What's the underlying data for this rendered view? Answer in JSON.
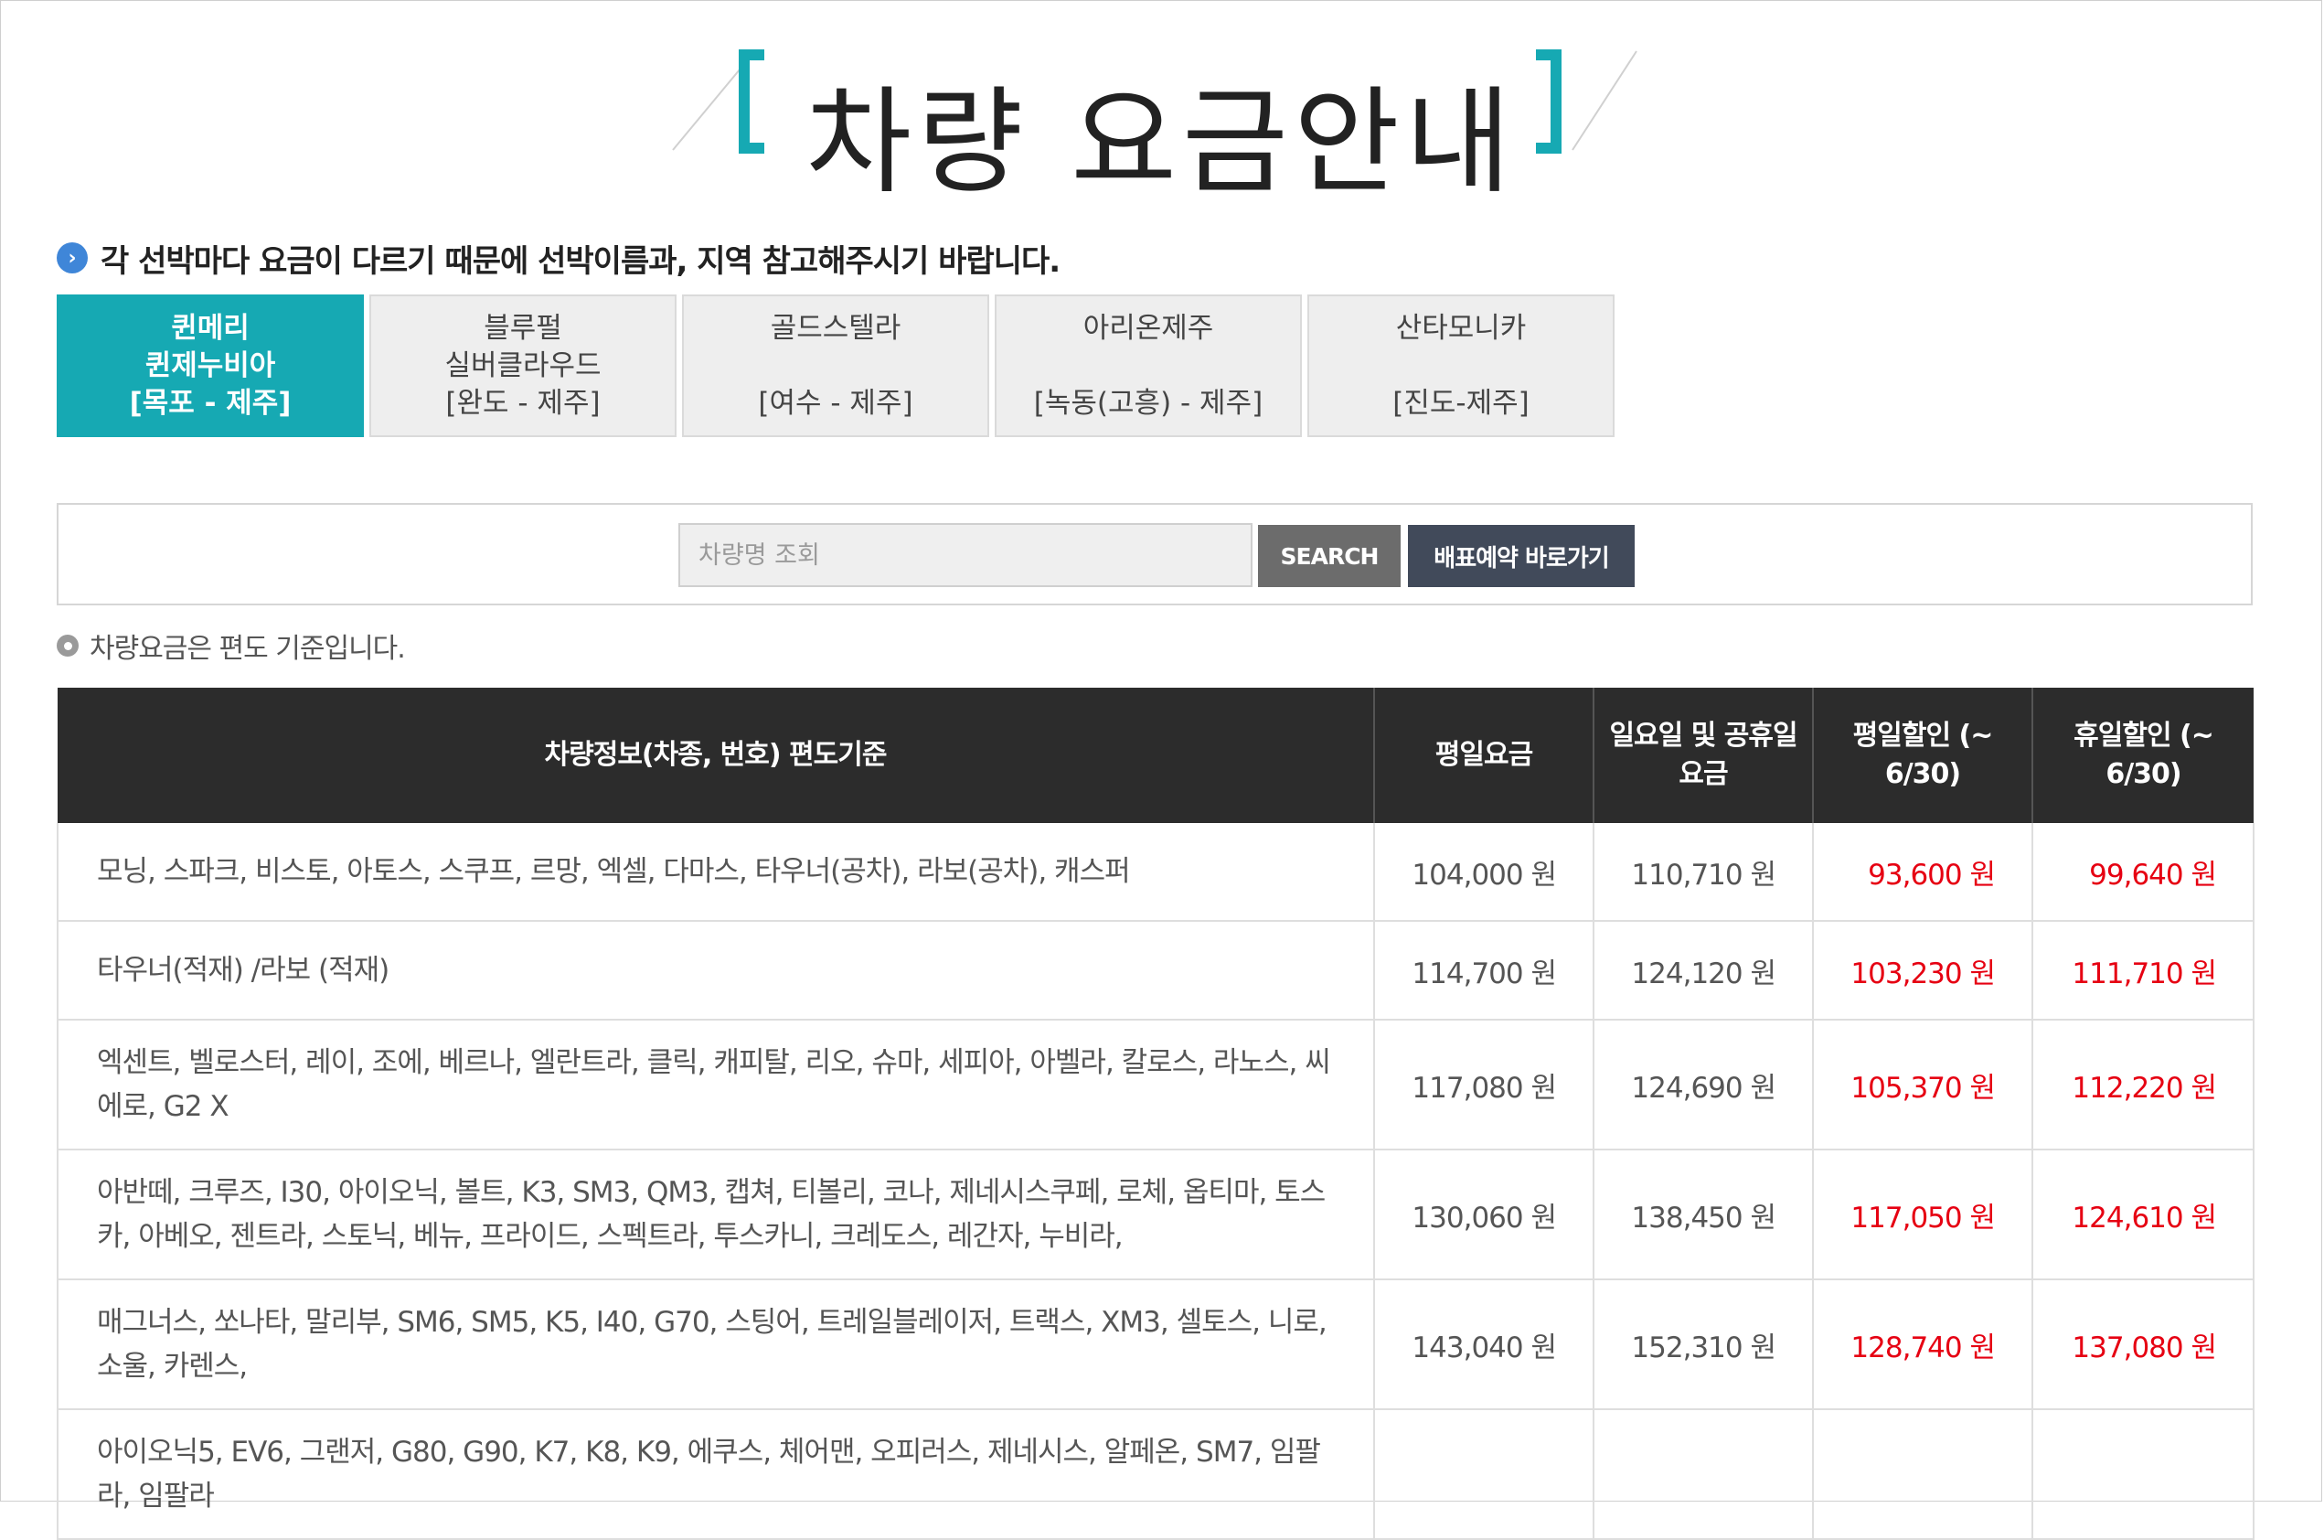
{
  "page": {
    "title": "차량 요금안내"
  },
  "notice": "각 선박마다 요금이 다르기 때문에 선박이름과, 지역 참고해주시기 바랍니다.",
  "tabs": [
    {
      "line1": "퀸메리",
      "line2": "퀸제누비아",
      "line3": "[목포 - 제주]",
      "active": true
    },
    {
      "line1": "블루펄",
      "line2": "실버클라우드",
      "line3": "[완도 - 제주]",
      "active": false
    },
    {
      "line1": "골드스텔라",
      "line2": "",
      "line3": "[여수 - 제주]",
      "active": false
    },
    {
      "line1": "아리온제주",
      "line2": "",
      "line3": "[녹동(고흥) - 제주]",
      "active": false
    },
    {
      "line1": "산타모니카",
      "line2": "",
      "line3": "[진도-제주]",
      "active": false
    }
  ],
  "search": {
    "placeholder": "차량명 조회",
    "value": "",
    "search_label": "SEARCH",
    "reserve_label": "배표예약 바로가기"
  },
  "info": "차량요금은 편도 기준입니다.",
  "table": {
    "headers": {
      "vehicle": "차량정보(차종, 번호) 편도기준",
      "weekday": "평일요금",
      "holiday": "일요일 및 공휴일 요금",
      "weekday_discount": "평일할인 (~ 6/30)",
      "holiday_discount": "휴일할인 (~ 6/30)"
    },
    "rows": [
      {
        "vehicle": "모닝, 스파크, 비스토, 아토스, 스쿠프, 르망, 엑셀, 다마스, 타우너(공차), 라보(공차), 캐스퍼",
        "weekday": "104,000 원",
        "holiday": "110,710 원",
        "weekday_discount": "93,600 원",
        "holiday_discount": "99,640 원"
      },
      {
        "vehicle": "타우너(적재) /라보 (적재)",
        "weekday": "114,700 원",
        "holiday": "124,120 원",
        "weekday_discount": "103,230 원",
        "holiday_discount": "111,710 원"
      },
      {
        "vehicle": "엑센트, 벨로스터, 레이, 조에, 베르나, 엘란트라, 클릭, 캐피탈, 리오, 슈마, 세피아, 아벨라, 칼로스, 라노스, 씨에로, G2 X",
        "weekday": "117,080 원",
        "holiday": "124,690 원",
        "weekday_discount": "105,370 원",
        "holiday_discount": "112,220 원"
      },
      {
        "vehicle": "아반떼, 크루즈, I30, 아이오닉, 볼트, K3, SM3, QM3, 캡쳐, 티볼리, 코나, 제네시스쿠페, 로체, 옵티마, 토스카, 아베오, 젠트라, 스토닉, 베뉴, 프라이드, 스펙트라, 투스카니, 크레도스, 레간자, 누비라,",
        "weekday": "130,060 원",
        "holiday": "138,450 원",
        "weekday_discount": "117,050 원",
        "holiday_discount": "124,610 원"
      },
      {
        "vehicle": "매그너스, 쏘나타, 말리부, SM6, SM5, K5, I40, G70, 스팅어, 트레일블레이저, 트랙스, XM3, 셀토스, 니로, 소울, 카렌스,",
        "weekday": "143,040 원",
        "holiday": "152,310 원",
        "weekday_discount": "128,740 원",
        "holiday_discount": "137,080 원"
      },
      {
        "vehicle": "아이오닉5, EV6, 그랜저, G80, G90, K7, K8, K9, 에쿠스, 체어맨, 오피러스, 제네시스, 알페온, SM7, 임팔라, 임팔라",
        "weekday": "",
        "holiday": "",
        "weekday_discount": "",
        "holiday_discount": ""
      }
    ]
  },
  "colors": {
    "accent": "#16a9b3",
    "header_bg": "#2c2c2c",
    "discount_red": "#e60012",
    "search_button": "#6c6c6c",
    "reserve_button": "#414a5a",
    "notice_icon": "#3f86d8"
  },
  "icons": {
    "notice": "chevron-right-circle-icon",
    "info": "gray-dot-icon",
    "title_brackets": "bracket-icon"
  }
}
